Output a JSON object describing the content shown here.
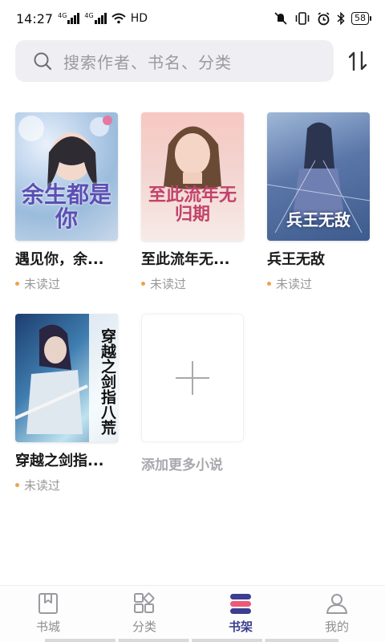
{
  "status_bar": {
    "time": "14:27",
    "network_label": "HD",
    "sim1": "4G",
    "sim2": "4G",
    "battery": "58"
  },
  "search": {
    "placeholder": "搜索作者、书名、分类",
    "icon": "search-icon",
    "sort_icon": "sort-icon"
  },
  "books": [
    {
      "title": "遇见你，余...",
      "cover_title": "余生都是你",
      "status": "未读过"
    },
    {
      "title": "至此流年无...",
      "cover_title": "至此流年无归期",
      "status": "未读过"
    },
    {
      "title": "兵王无敌",
      "cover_title": "兵王无敌",
      "status": "未读过"
    },
    {
      "title": "穿越之剑指...",
      "cover_title": "穿越之剑指八荒",
      "status": "未读过"
    }
  ],
  "add_more": {
    "label": "添加更多小说"
  },
  "nav": [
    {
      "label": "书城",
      "icon": "bookmark-icon",
      "active": false
    },
    {
      "label": "分类",
      "icon": "category-icon",
      "active": false
    },
    {
      "label": "书架",
      "icon": "bookshelf-icon",
      "active": true
    },
    {
      "label": "我的",
      "icon": "profile-icon",
      "active": false
    }
  ],
  "colors": {
    "accent": "#3a3f8f",
    "status_dot": "#f0a24a"
  }
}
